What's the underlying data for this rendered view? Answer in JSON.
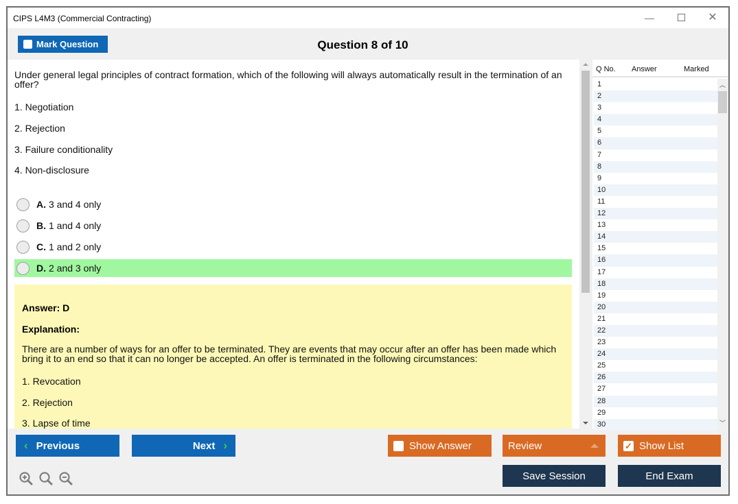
{
  "window": {
    "title": "CIPS L4M3 (Commercial Contracting)",
    "minimize_icon": "minimize-icon",
    "maximize_icon": "maximize-icon",
    "close_icon": "close-icon"
  },
  "toolbar": {
    "mark_question_label": "Mark Question",
    "mark_question_checked": false,
    "question_counter": "Question 8 of 10"
  },
  "question": {
    "text": "Under general legal principles of contract formation, which of the following will always automatically result in the termination of an offer?",
    "statements": [
      "1. Negotiation",
      "2. Rejection",
      "3. Failure conditionality",
      "4. Non-disclosure"
    ],
    "options": [
      {
        "letter": "A.",
        "text": "3 and 4 only",
        "correct": false
      },
      {
        "letter": "B.",
        "text": "1 and 4 only",
        "correct": false
      },
      {
        "letter": "C.",
        "text": "1 and 2 only",
        "correct": false
      },
      {
        "letter": "D.",
        "text": "2 and 3 only",
        "correct": true
      }
    ]
  },
  "answer": {
    "answer_label": "Answer: D",
    "explanation_label": "Explanation:",
    "explanation_text": "There are a number of ways for an offer to be terminated. They are events that may occur after an offer has been made which bring it to an end so that it can no longer be accepted. An offer is terminated in the following circumstances:",
    "items": [
      "1. Revocation",
      "2. Rejection",
      "3. Lapse of time"
    ]
  },
  "question_list": {
    "columns": [
      "Q No.",
      "Answer",
      "Marked"
    ],
    "rows": [
      "1",
      "2",
      "3",
      "4",
      "5",
      "6",
      "7",
      "8",
      "9",
      "10",
      "11",
      "12",
      "13",
      "14",
      "15",
      "16",
      "17",
      "18",
      "19",
      "20",
      "21",
      "22",
      "23",
      "24",
      "25",
      "26",
      "27",
      "28",
      "29",
      "30"
    ]
  },
  "footer": {
    "previous_label": "Previous",
    "next_label": "Next",
    "show_answer_label": "Show Answer",
    "show_answer_checked": false,
    "review_label": "Review",
    "show_list_label": "Show List",
    "show_list_checked": true,
    "save_session_label": "Save Session",
    "end_exam_label": "End Exam",
    "zoom_icons": [
      "zoom-in-icon",
      "zoom-reset-icon",
      "zoom-out-icon"
    ]
  },
  "colors": {
    "primary_blue": "#0f67b5",
    "orange": "#d96a23",
    "dark_navy": "#1e364f",
    "correct_green": "#a0f7a0",
    "answer_yellow": "#fdf8b7",
    "chevron_green": "#3fd03f"
  }
}
